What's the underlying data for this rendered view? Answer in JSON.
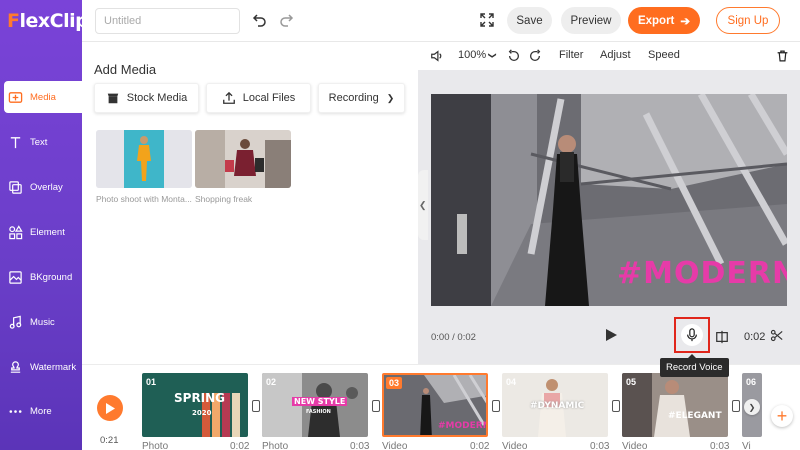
{
  "app": {
    "logo_mark": "F",
    "logo_rest": "lexClip"
  },
  "sidebar": {
    "items": [
      {
        "label": "Media",
        "icon": "media-icon",
        "active": true
      },
      {
        "label": "Text",
        "icon": "text-icon"
      },
      {
        "label": "Overlay",
        "icon": "overlay-icon"
      },
      {
        "label": "Element",
        "icon": "element-icon"
      },
      {
        "label": "BKground",
        "icon": "background-icon"
      },
      {
        "label": "Music",
        "icon": "music-icon"
      },
      {
        "label": "Watermark",
        "icon": "watermark-icon"
      },
      {
        "label": "More",
        "icon": "more-icon"
      }
    ]
  },
  "header": {
    "title_placeholder": "Untitled",
    "save_label": "Save",
    "preview_label": "Preview",
    "export_label": "Export",
    "signup_label": "Sign Up"
  },
  "media_panel": {
    "title": "Add Media",
    "buttons": {
      "stock": "Stock Media",
      "local": "Local Files",
      "recording": "Recording"
    },
    "items": [
      {
        "caption": "Photo shoot with Monta..."
      },
      {
        "caption": "Shopping freak"
      }
    ]
  },
  "editor_toolbar": {
    "zoom": "100%",
    "filter": "Filter",
    "adjust": "Adjust",
    "speed": "Speed"
  },
  "preview": {
    "overlay_text": "#MODERN",
    "current_time": "0:00 / 0:02",
    "duration": "0:02",
    "record_tooltip": "Record Voice"
  },
  "timeline": {
    "time": "0:21",
    "clips": [
      {
        "num": "01",
        "type": "Photo",
        "duration": "0:02",
        "label": "SPRING",
        "sub": "2020"
      },
      {
        "num": "02",
        "type": "Photo",
        "duration": "0:03",
        "label": "NEW STYLE",
        "sub": "FASHION"
      },
      {
        "num": "03",
        "type": "Video",
        "duration": "0:02",
        "label": "#MODERN",
        "selected": true
      },
      {
        "num": "04",
        "type": "Video",
        "duration": "0:03",
        "label": "#DYNAMIC"
      },
      {
        "num": "05",
        "type": "Video",
        "duration": "0:03",
        "label": "#ELEGANT"
      },
      {
        "num": "06",
        "type": "Vi",
        "duration": ""
      }
    ]
  },
  "colors": {
    "accent": "#ff6d1f",
    "sidebar": "#6a3ec8",
    "record_highlight": "#e0261b",
    "overlay_text": "#e63ba8"
  }
}
